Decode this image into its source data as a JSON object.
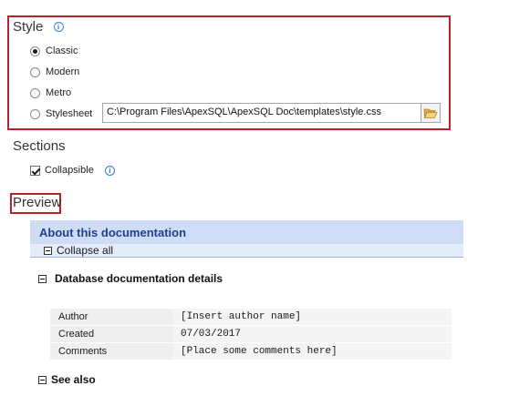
{
  "style_section": {
    "heading": "Style",
    "options": [
      {
        "label": "Classic",
        "checked": true
      },
      {
        "label": "Modern",
        "checked": false
      },
      {
        "label": "Metro",
        "checked": false
      },
      {
        "label": "Stylesheet",
        "checked": false
      }
    ],
    "stylesheet_path": "C:\\Program Files\\ApexSQL\\ApexSQL Doc\\templates\\style.css"
  },
  "sections_section": {
    "heading": "Sections",
    "collapsible_label": "Collapsible",
    "collapsible_checked": true
  },
  "preview": {
    "heading": "Preview",
    "doc_title": "About this documentation",
    "collapse_all_label": "Collapse all",
    "details_heading": "Database documentation details",
    "details_rows": [
      {
        "key": "Author",
        "value": "[Insert author name]"
      },
      {
        "key": "Created",
        "value": "07/03/2017"
      },
      {
        "key": "Comments",
        "value": "[Place some comments here]"
      }
    ],
    "see_also_heading": "See also"
  },
  "colors": {
    "highlight": "#b8232a",
    "preview_title_bg": "#cfdcf5",
    "preview_title_text": "#1f3f91"
  },
  "icons": [
    "info-icon",
    "folder-open-icon",
    "collapse-icon"
  ]
}
